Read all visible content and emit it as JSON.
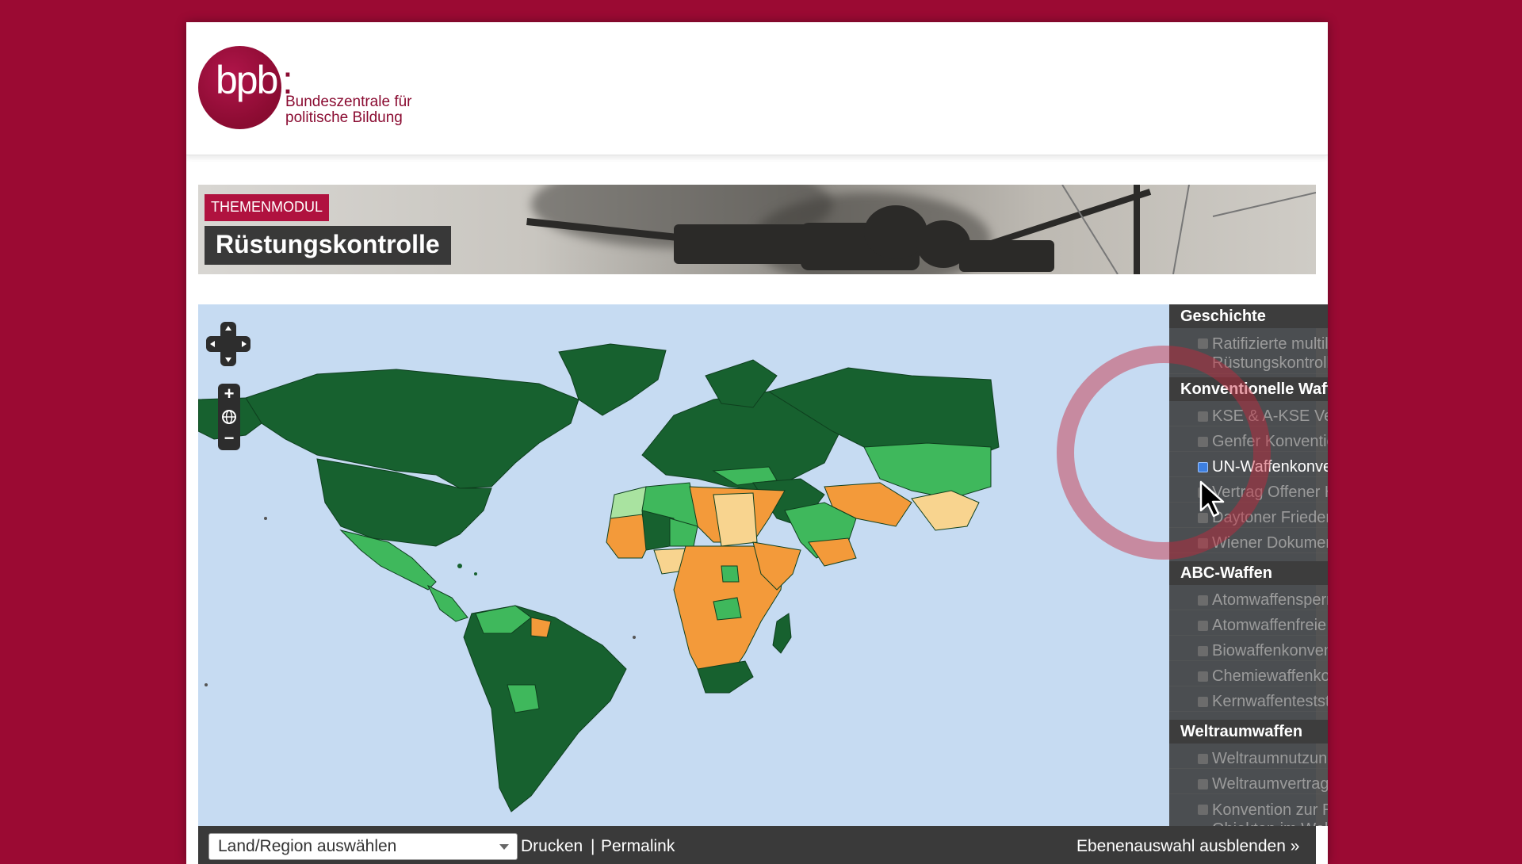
{
  "site": {
    "logo_letters": "bpb",
    "logo_colon": ":",
    "logo_line1": "Bundeszentrale für",
    "logo_line2": "politische Bildung"
  },
  "banner": {
    "tag": "THEMENMODUL",
    "title": "Rüstungskontrolle"
  },
  "map_controls": {
    "zoom_in": "+",
    "zoom_out": "−",
    "pan_icon": "pan-arrows-icon",
    "globe_icon": "globe-icon"
  },
  "layers": {
    "categories": [
      {
        "label": "Geschichte",
        "items": [
          {
            "label": "Ratifizierte multilaterale Rüstungskontrollabkommen",
            "checked": false
          }
        ]
      },
      {
        "label": "Konventionelle Waffen",
        "items": [
          {
            "label": "KSE & A-KSE Vertrag",
            "checked": false
          },
          {
            "label": "Genfer Konventionen",
            "checked": false
          },
          {
            "label": "UN-Waffenkonvention",
            "checked": true
          },
          {
            "label": "Vertrag Offener Himmel",
            "checked": false
          },
          {
            "label": "Daytoner Friedensabkommen",
            "checked": false
          },
          {
            "label": "Wiener Dokument",
            "checked": false
          }
        ]
      },
      {
        "label": "ABC-Waffen",
        "items": [
          {
            "label": "Atomwaffensperrvertrag",
            "checked": false
          },
          {
            "label": "Atomwaffenfreie Zonen",
            "checked": false
          },
          {
            "label": "Biowaffenkonvention",
            "checked": false
          },
          {
            "label": "Chemiewaffenkonvention",
            "checked": false
          },
          {
            "label": "Kernwaffenteststopp-Vertrag",
            "checked": false
          }
        ]
      },
      {
        "label": "Weltraumwaffen",
        "items": [
          {
            "label": "Weltraumnutzung",
            "checked": false
          },
          {
            "label": "Weltraumvertrag",
            "checked": false
          },
          {
            "label": "Konvention zur Registrierung von Objekten im Weltraum",
            "checked": false
          }
        ]
      }
    ],
    "info_icon": "info-icon",
    "legend_icon": "legend-icon"
  },
  "bottom_bar": {
    "region_select": "Land/Region auswählen",
    "print": "Drucken",
    "separator": "|",
    "permalink": "Permalink",
    "hide_layers": "Ebenenauswahl ausblenden »"
  },
  "colors": {
    "brand": "#9b0a33",
    "ocean": "#c6dbf2",
    "ratified": "#17612f",
    "signed": "#3fb85c",
    "light": "#a9e3a0",
    "not_member": "#f39a3a",
    "no_data": "#f8d48f"
  }
}
